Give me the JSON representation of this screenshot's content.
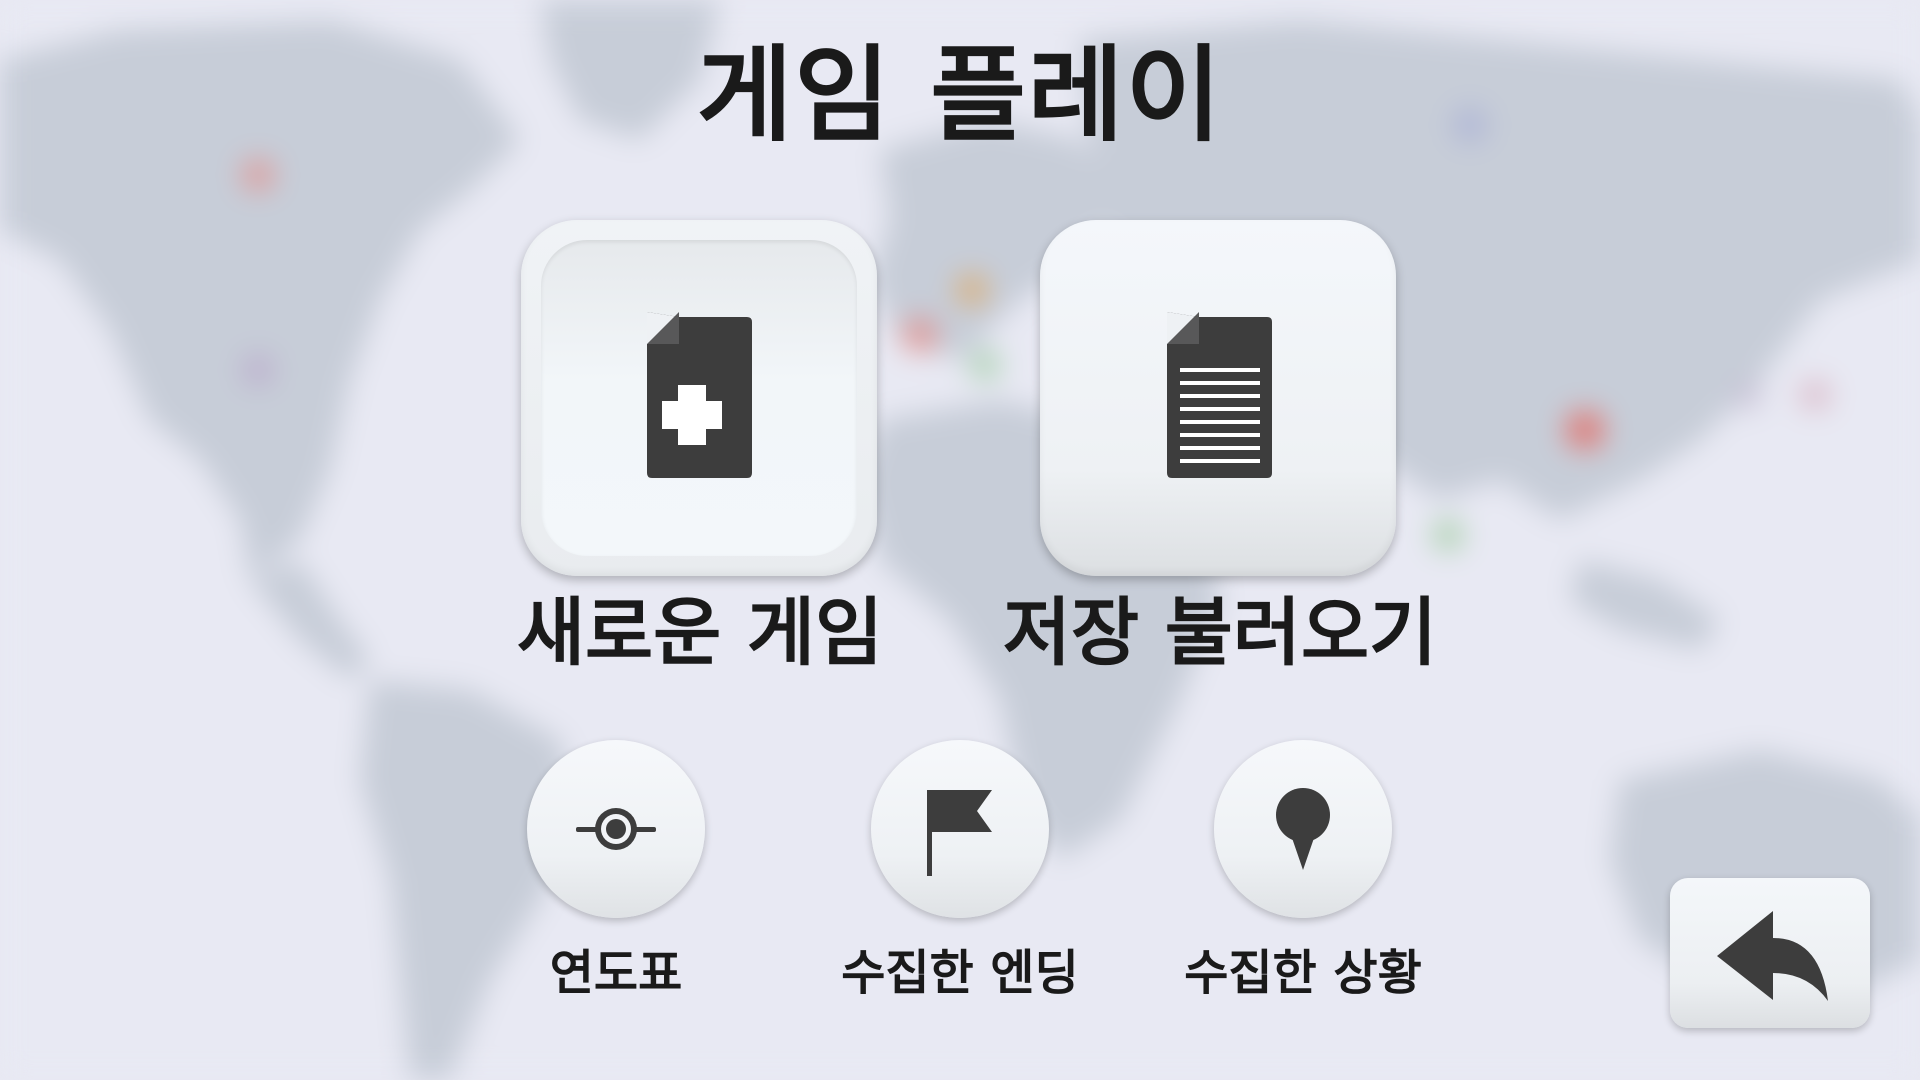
{
  "screen": {
    "title": "게임 플레이"
  },
  "main_buttons": {
    "new_game": {
      "label": "새로운 게임",
      "icon": "new-document-icon"
    },
    "load_save": {
      "label": "저장 불러오기",
      "icon": "document-icon"
    }
  },
  "secondary_buttons": {
    "timeline": {
      "label": "연도표",
      "icon": "timeline-node-icon"
    },
    "endings": {
      "label": "수집한 엔딩",
      "icon": "flag-icon"
    },
    "situations": {
      "label": "수집한 상황",
      "icon": "map-pin-icon"
    }
  },
  "back_button": {
    "icon": "back-arrow-icon"
  },
  "colors": {
    "background": "#e8e9f3",
    "map_land": "#c5cbd6",
    "icon": "#3d3d3d",
    "text": "#1a1a1a"
  }
}
